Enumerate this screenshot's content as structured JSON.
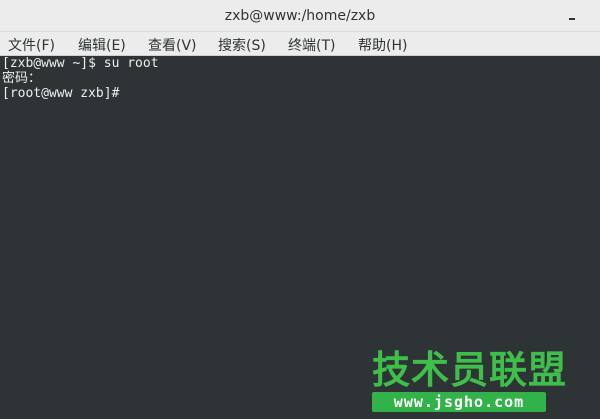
{
  "window": {
    "title": "zxb@www:/home/zxb"
  },
  "menu": {
    "items": [
      {
        "label": "文件(F)"
      },
      {
        "label": "编辑(E)"
      },
      {
        "label": "查看(V)"
      },
      {
        "label": "搜索(S)"
      },
      {
        "label": "终端(T)"
      },
      {
        "label": "帮助(H)"
      }
    ]
  },
  "terminal": {
    "lines": [
      "[zxb@www ~]$ su root",
      "密码：",
      "[root@www zxb]# "
    ]
  },
  "watermark": {
    "title": "技术员联盟",
    "url": "www.jsgho.com"
  },
  "colors": {
    "terminal_bg": "#2e3436",
    "terminal_fg": "#eeeeec",
    "chrome_bg": "#ececec",
    "watermark_green": "#3fbf4a"
  },
  "icons": {
    "minimize": "minimize-icon"
  }
}
